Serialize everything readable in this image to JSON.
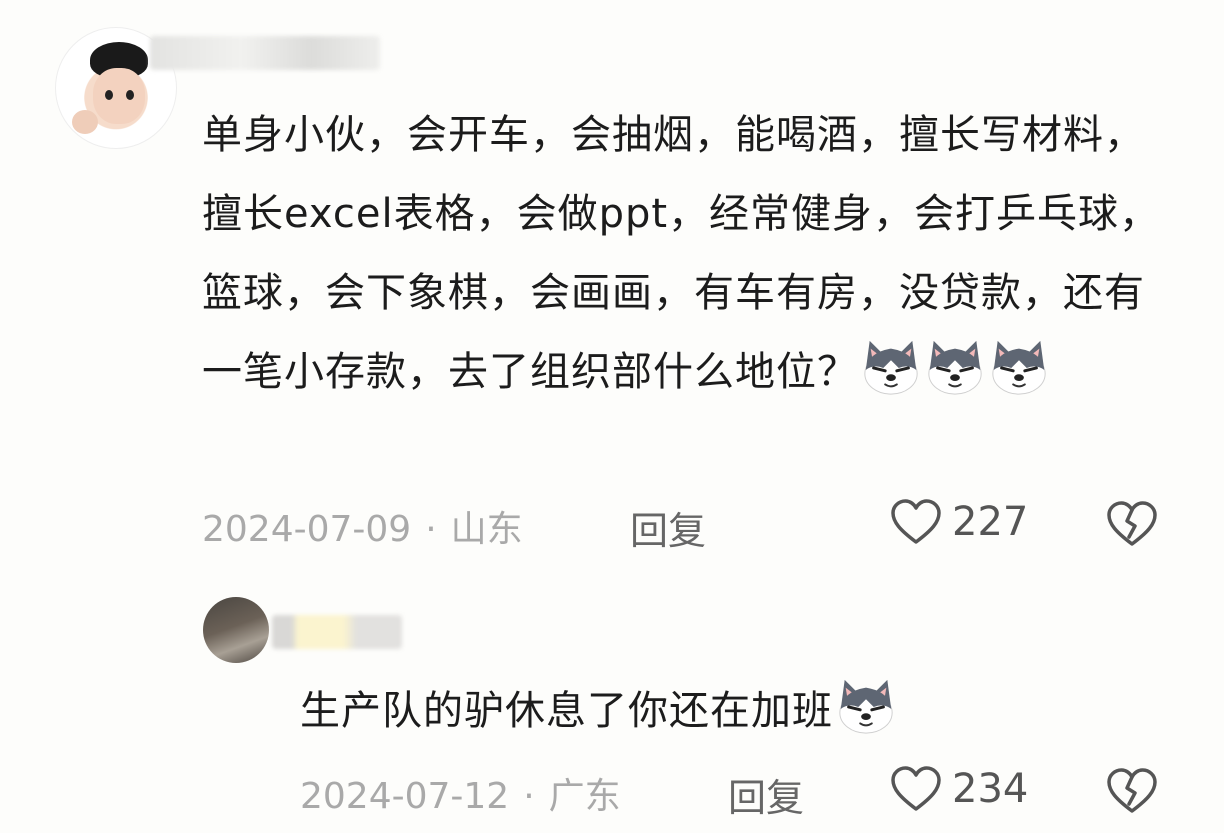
{
  "comment": {
    "text": "单身小伙，会开车，会抽烟，能喝酒，擅长写材料，擅长excel表格，会做ppt，经常健身，会打乒乓球，篮球，会下象棋，会画画，有车有房，没贷款，还有一笔小存款，去了组织部什么地位？",
    "emoji_count": 3,
    "date": "2024-07-09",
    "separator": "·",
    "location": "山东",
    "reply_label": "回复",
    "likes": "227"
  },
  "reply": {
    "text": "生产队的驴休息了你还在加班",
    "emoji_count": 1,
    "date": "2024-07-12",
    "separator": "·",
    "location": "广东",
    "reply_label": "回复",
    "likes": "234"
  },
  "icons": {
    "emoji": "husky-dog-emoji-icon",
    "like": "heart-outline-icon",
    "dislike": "broken-heart-icon"
  },
  "colors": {
    "background": "#fdfdfb",
    "text": "#1c1c1c",
    "meta": "#a9a9a9",
    "icon": "#555555"
  }
}
